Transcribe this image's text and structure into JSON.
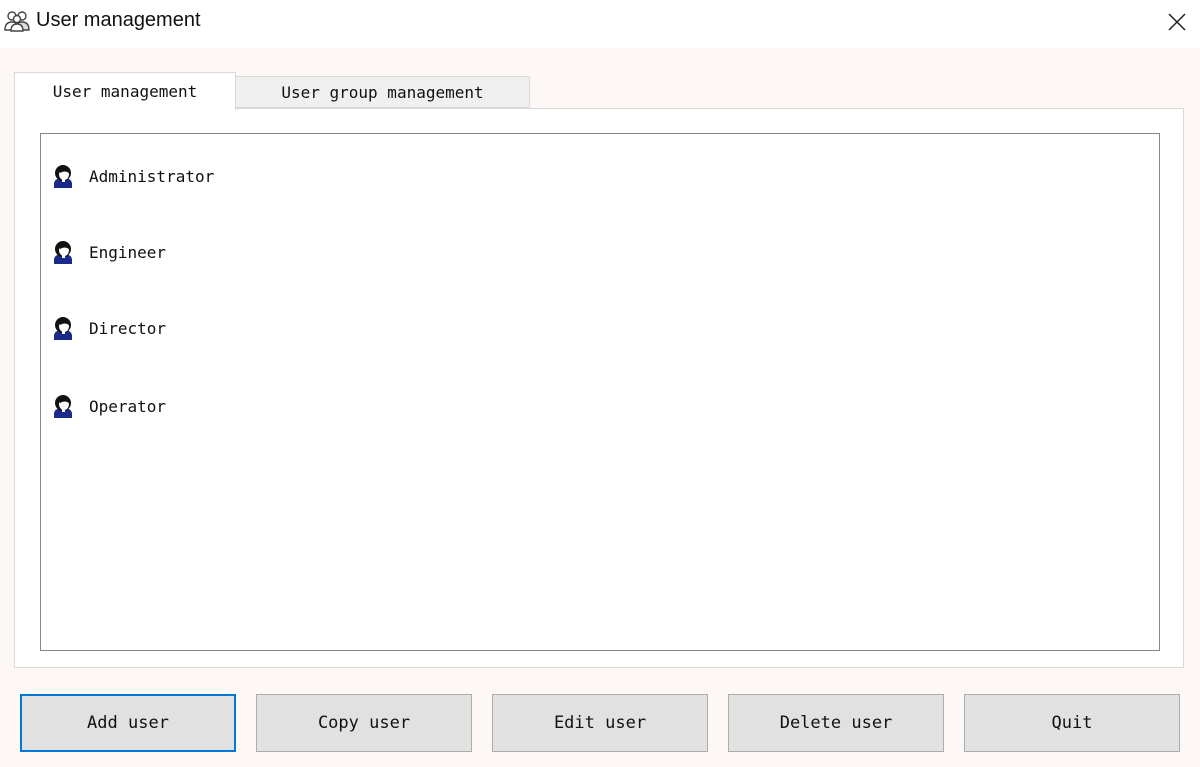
{
  "window": {
    "title": "User management",
    "title_icon": "users-icon",
    "close_icon": "close-icon"
  },
  "tabs": [
    {
      "label": "User management",
      "active": true
    },
    {
      "label": "User group management",
      "active": false
    }
  ],
  "users": [
    {
      "label": "Administrator",
      "icon": "user-icon"
    },
    {
      "label": "Engineer",
      "icon": "user-icon"
    },
    {
      "label": "Director",
      "icon": "user-icon"
    },
    {
      "label": "Operator",
      "icon": "user-icon"
    }
  ],
  "buttons": {
    "add": "Add user",
    "copy": "Copy user",
    "edit": "Edit user",
    "delete": "Delete user",
    "quit": "Quit"
  },
  "colors": {
    "focus_accent": "#0078d7",
    "button_face": "#e1e1e1"
  }
}
